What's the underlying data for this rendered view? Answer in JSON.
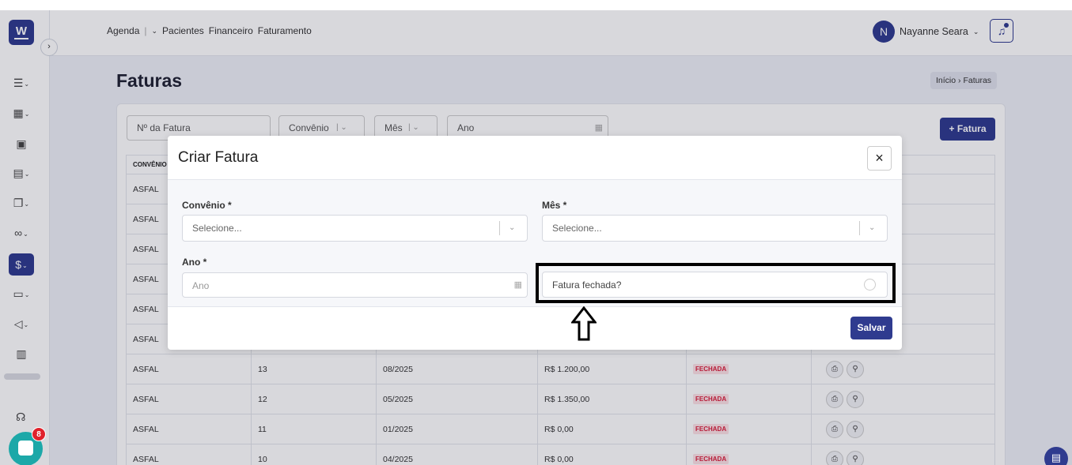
{
  "nav": {
    "agenda": "Agenda",
    "pacientes": "Pacientes",
    "financeiro": "Financeiro",
    "faturamento": "Faturamento"
  },
  "user": {
    "initial": "N",
    "name": "Nayanne Seara"
  },
  "page": {
    "title": "Faturas"
  },
  "breadcrumb": {
    "home": "Início",
    "current": "Faturas"
  },
  "filters": {
    "invoice_number_placeholder": "Nº da Fatura",
    "convenio": "Convênio",
    "mes": "Mês",
    "ano_placeholder": "Ano",
    "add_button": "+ Fatura"
  },
  "table": {
    "header_convenio": "CONVÊNIO",
    "rows": [
      {
        "convenio": "ASFAL",
        "numero": "",
        "periodo": "",
        "valor": "",
        "status": ""
      },
      {
        "convenio": "ASFAL",
        "numero": "",
        "periodo": "",
        "valor": "",
        "status": ""
      },
      {
        "convenio": "ASFAL",
        "numero": "",
        "periodo": "",
        "valor": "",
        "status": ""
      },
      {
        "convenio": "ASFAL",
        "numero": "",
        "periodo": "",
        "valor": "",
        "status": ""
      },
      {
        "convenio": "ASFAL",
        "numero": "",
        "periodo": "",
        "valor": "",
        "status": ""
      },
      {
        "convenio": "ASFAL",
        "numero": "",
        "periodo": "",
        "valor": "",
        "status": ""
      },
      {
        "convenio": "ASFAL",
        "numero": "13",
        "periodo": "08/2025",
        "valor": "R$ 1.200,00",
        "status": "FECHADA"
      },
      {
        "convenio": "ASFAL",
        "numero": "12",
        "periodo": "05/2025",
        "valor": "R$ 1.350,00",
        "status": "FECHADA"
      },
      {
        "convenio": "ASFAL",
        "numero": "11",
        "periodo": "01/2025",
        "valor": "R$ 0,00",
        "status": "FECHADA"
      },
      {
        "convenio": "ASFAL",
        "numero": "10",
        "periodo": "04/2025",
        "valor": "R$ 0,00",
        "status": "FECHADA"
      }
    ]
  },
  "modal": {
    "title": "Criar Fatura",
    "close": "×",
    "convenio_label": "Convênio *",
    "convenio_placeholder": "Selecione...",
    "mes_label": "Mês *",
    "mes_placeholder": "Selecione...",
    "ano_label": "Ano *",
    "ano_placeholder": "Ano",
    "fechada_label": "Fatura fechada?",
    "save": "Salvar"
  },
  "chat": {
    "unread": "8"
  },
  "colors": {
    "primary": "#2f3b8f",
    "closed_badge_text": "#d91e3c",
    "closed_badge_bg": "#fde2e5",
    "chat": "#1ca8a8"
  }
}
